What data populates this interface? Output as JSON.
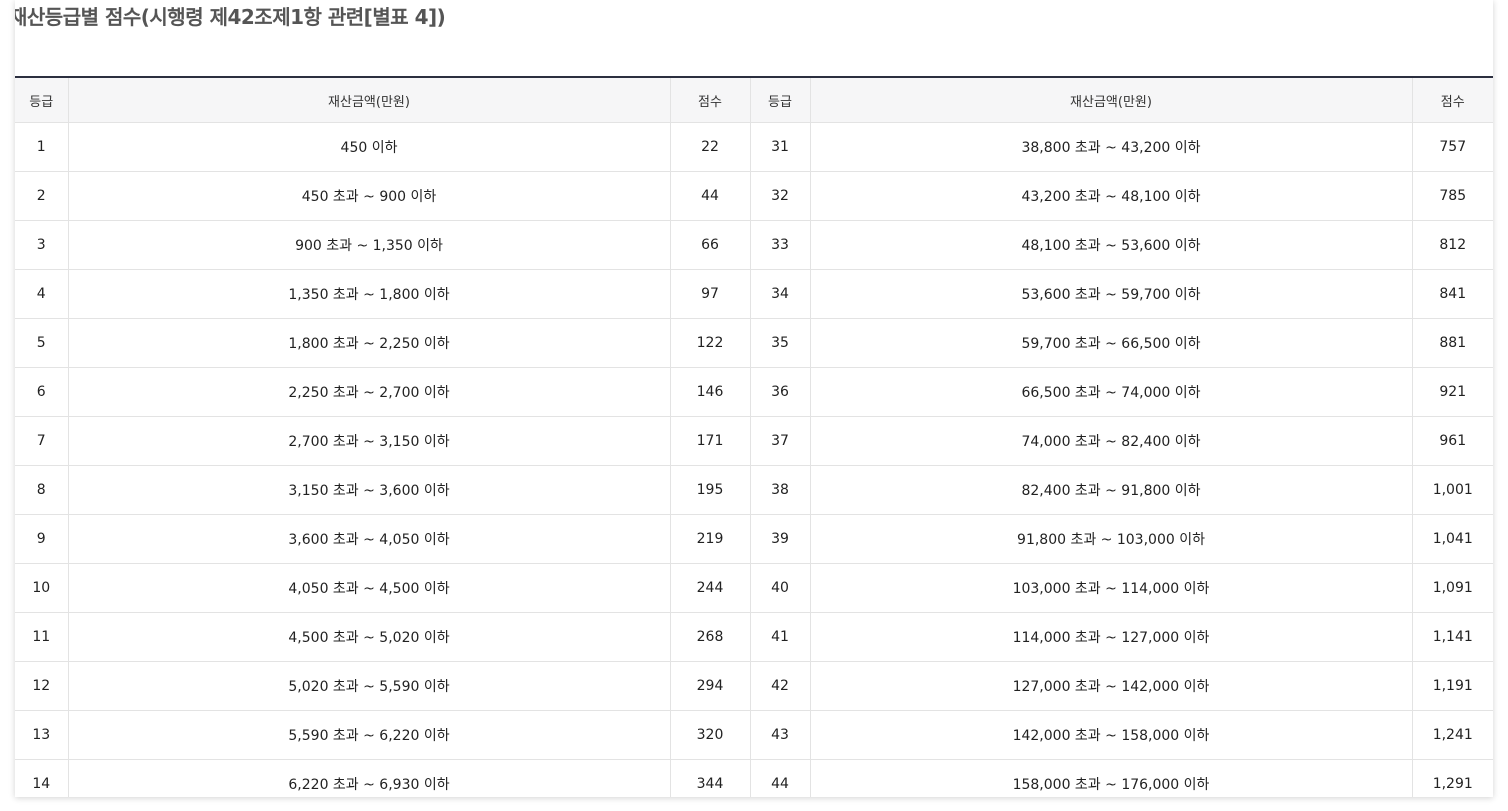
{
  "title": "재산등급별 점수(시행령 제42조제1항 관련[별표 4])",
  "table": {
    "headers": [
      "등급",
      "재산금액(만원)",
      "점수",
      "등급",
      "재산금액(만원)",
      "점수"
    ],
    "rows": [
      [
        "1",
        "450 이하",
        "22",
        "31",
        "38,800 초과 ~ 43,200 이하",
        "757"
      ],
      [
        "2",
        "450 초과 ~ 900 이하",
        "44",
        "32",
        "43,200 초과 ~ 48,100 이하",
        "785"
      ],
      [
        "3",
        "900 초과 ~ 1,350 이하",
        "66",
        "33",
        "48,100 초과 ~ 53,600 이하",
        "812"
      ],
      [
        "4",
        "1,350 초과 ~ 1,800 이하",
        "97",
        "34",
        "53,600 초과 ~ 59,700 이하",
        "841"
      ],
      [
        "5",
        "1,800 초과 ~ 2,250 이하",
        "122",
        "35",
        "59,700 초과 ~ 66,500 이하",
        "881"
      ],
      [
        "6",
        "2,250 초과 ~ 2,700 이하",
        "146",
        "36",
        "66,500 초과 ~ 74,000 이하",
        "921"
      ],
      [
        "7",
        "2,700 초과 ~ 3,150 이하",
        "171",
        "37",
        "74,000 초과 ~ 82,400 이하",
        "961"
      ],
      [
        "8",
        "3,150 초과 ~ 3,600 이하",
        "195",
        "38",
        "82,400 초과 ~ 91,800 이하",
        "1,001"
      ],
      [
        "9",
        "3,600 초과 ~ 4,050 이하",
        "219",
        "39",
        "91,800 초과 ~ 103,000 이하",
        "1,041"
      ],
      [
        "10",
        "4,050 초과 ~ 4,500 이하",
        "244",
        "40",
        "103,000 초과 ~ 114,000 이하",
        "1,091"
      ],
      [
        "11",
        "4,500 초과 ~ 5,020 이하",
        "268",
        "41",
        "114,000 초과 ~ 127,000 이하",
        "1,141"
      ],
      [
        "12",
        "5,020 초과 ~ 5,590 이하",
        "294",
        "42",
        "127,000 초과 ~ 142,000 이하",
        "1,191"
      ],
      [
        "13",
        "5,590 초과 ~ 6,220 이하",
        "320",
        "43",
        "142,000 초과 ~ 158,000 이하",
        "1,241"
      ],
      [
        "14",
        "6,220 초과 ~ 6,930 이하",
        "344",
        "44",
        "158,000 초과 ~ 176,000 이하",
        "1,291"
      ]
    ]
  }
}
